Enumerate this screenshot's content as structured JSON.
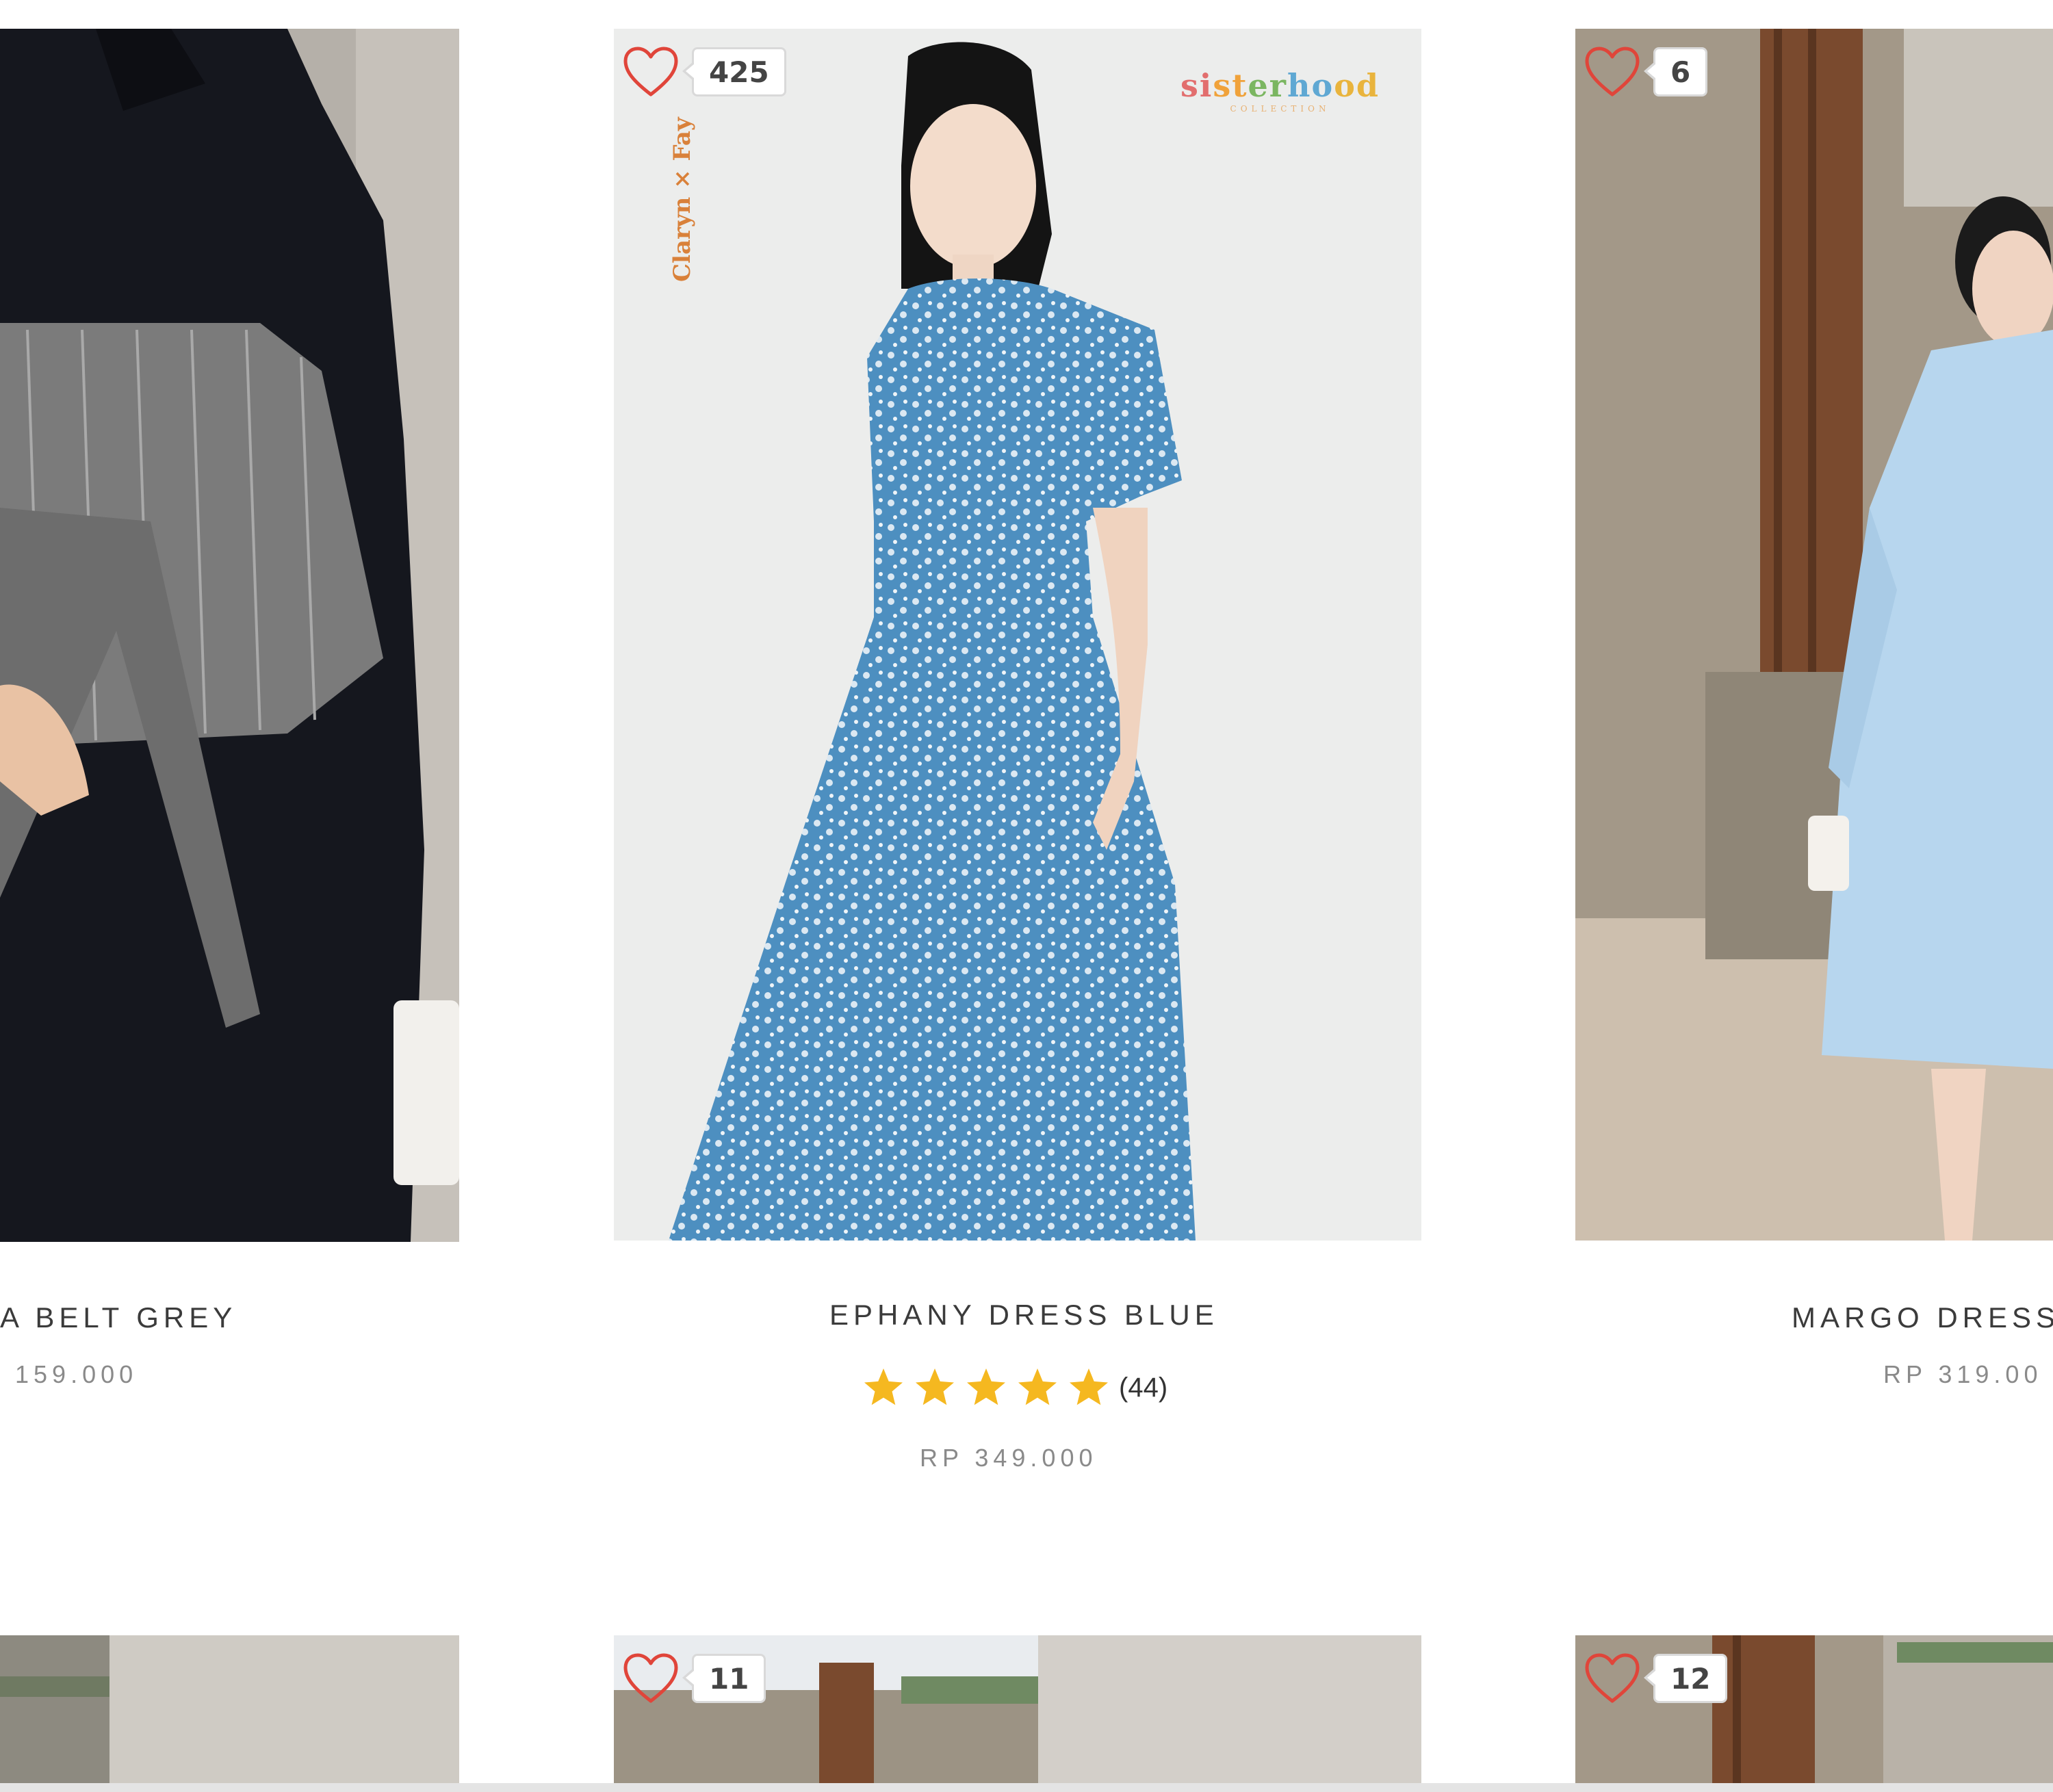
{
  "products": [
    {
      "title": "A BELT GREY",
      "price": "159.000",
      "colors": {
        "bg": "#b7b2ab",
        "garment": "#15171e",
        "belt": "#7c7c7c"
      }
    },
    {
      "title": "EPHANY DRESS BLUE",
      "wishlist_count": "425",
      "rating": {
        "stars": 5,
        "count": "(44)",
        "star_color": "#f5b820"
      },
      "price": "RP 349.000",
      "brand_logo": "sisterhood",
      "brand_logo_sub": "COLLECTION",
      "collab_text": "Claryn × Fay",
      "colors": {
        "bg": "#ecedec",
        "dress": "#4d8fc0"
      }
    },
    {
      "title": "MARGO DRESS",
      "wishlist_count": "6",
      "price": "RP 319.00",
      "colors": {
        "bg": "#a59a8c",
        "dress": "#b7d6ee",
        "wood": "#7a4a2e"
      }
    }
  ],
  "second_row": [
    {
      "wishlist_count": ""
    },
    {
      "wishlist_count": "11"
    },
    {
      "wishlist_count": "12"
    }
  ],
  "icons": {
    "wishlist": "heart-outline-icon",
    "rating": "star-icon"
  },
  "accent_colors": {
    "heart": "#e0453a",
    "star": "#f5b820"
  }
}
